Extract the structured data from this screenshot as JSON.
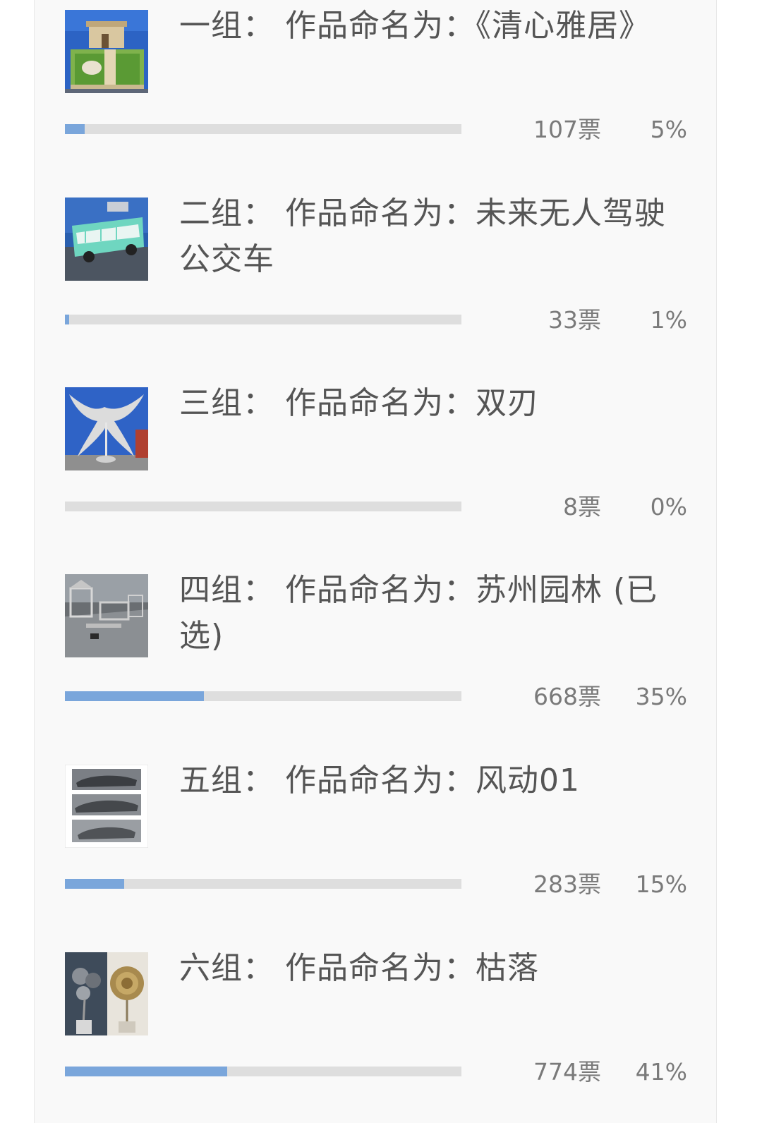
{
  "vote_unit": "票",
  "accent_color": "#7aa6db",
  "items": [
    {
      "title": "一组： 作品命名为：《清心雅居》",
      "votes": "107票",
      "percent": "5%",
      "share": 0.05,
      "thumb_icon": "house-model-photo"
    },
    {
      "title": "二组： 作品命名为：未来无人驾驶公交车",
      "votes": "33票",
      "percent": "1%",
      "share": 0.01,
      "thumb_icon": "bus-model-photo"
    },
    {
      "title": "三组： 作品命名为：双刃",
      "votes": "8票",
      "percent": "0%",
      "share": 0.0,
      "thumb_icon": "blade-sculpture-photo"
    },
    {
      "title": "四组： 作品命名为：苏州园林 (已选)",
      "votes": "668票",
      "percent": "35%",
      "share": 0.35,
      "thumb_icon": "garden-model-photo"
    },
    {
      "title": "五组： 作品命名为：风动01",
      "votes": "283票",
      "percent": "15%",
      "share": 0.15,
      "thumb_icon": "car-model-collage-photo"
    },
    {
      "title": "六组： 作品命名为：枯落",
      "votes": "774票",
      "percent": "41%",
      "share": 0.41,
      "thumb_icon": "metal-rose-photo"
    }
  ]
}
